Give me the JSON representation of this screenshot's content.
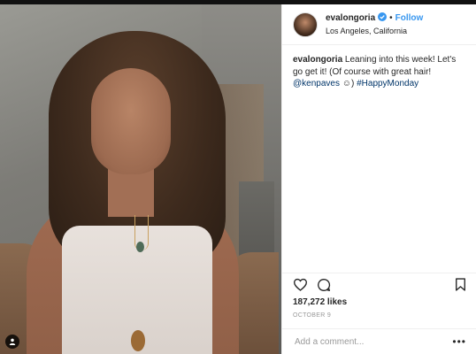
{
  "post": {
    "username": "evalongoria",
    "follow_label": "Follow",
    "dot": "•",
    "location": "Los Angeles, California",
    "caption": {
      "username": "evalongoria",
      "text": "Leaning into this week! Let's go get it! (Of course with great hair!",
      "mention": "@kenpaves",
      "emoji": "☺",
      "close": ")",
      "hashtag": "#HappyMonday"
    },
    "likes": "187,272 likes",
    "date": "OCTOBER 9",
    "comment_placeholder": "Add a comment...",
    "more": "•••"
  },
  "colors": {
    "accent": "#3897f0",
    "text": "#262626",
    "muted": "#999999",
    "link": "#003569"
  },
  "icons": [
    "verified-badge-icon",
    "heart-icon",
    "comment-icon",
    "bookmark-icon",
    "user-tag-icon",
    "more-options-icon"
  ]
}
